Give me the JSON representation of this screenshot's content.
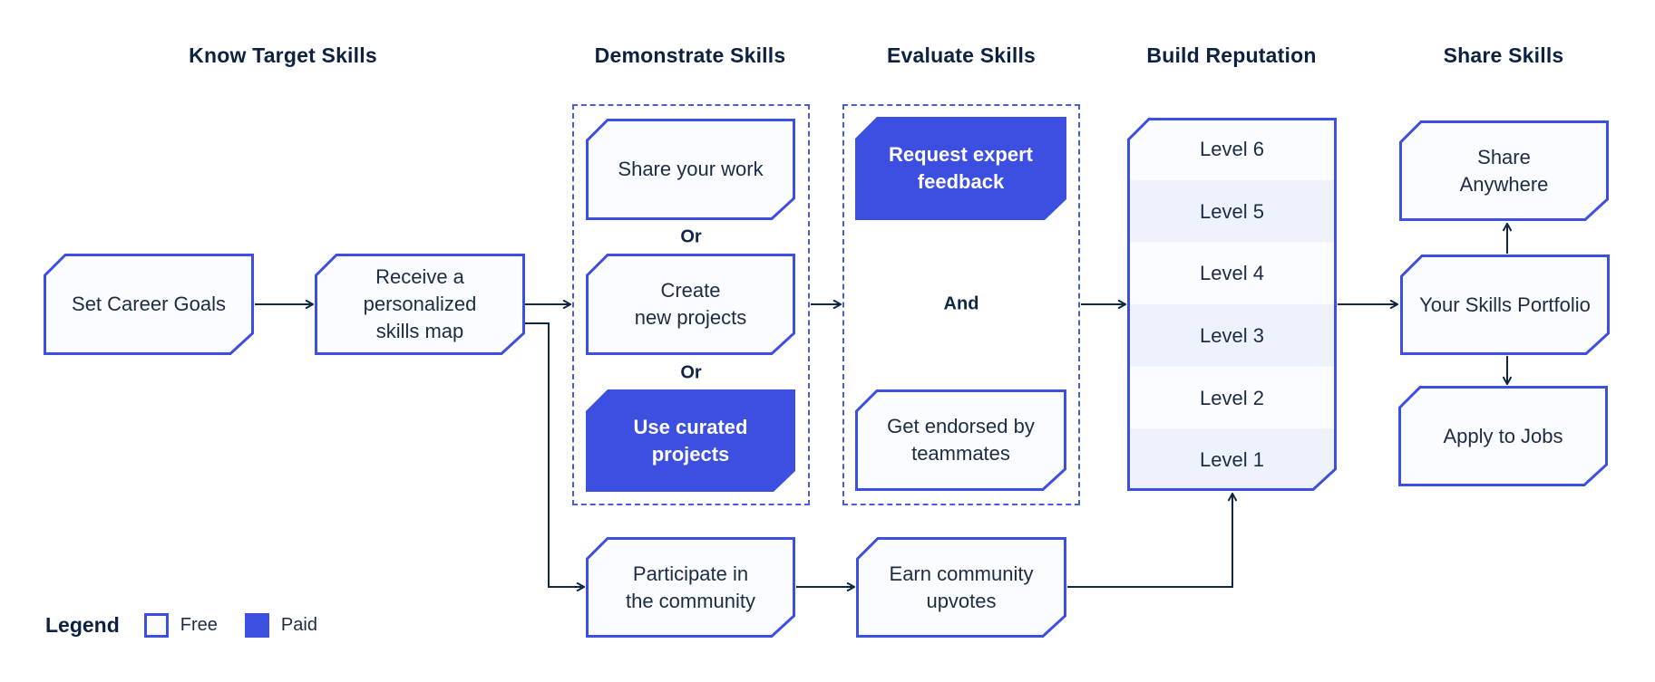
{
  "colors": {
    "accent": "#3d4fe0",
    "text": "#0d2240",
    "free_fill": "#fbfcff",
    "band_fill": "#eef2fd",
    "line": "#0f2744"
  },
  "headings": {
    "know": "Know Target Skills",
    "demonstrate": "Demonstrate Skills",
    "evaluate": "Evaluate Skills",
    "reputation": "Build Reputation",
    "share": "Share Skills"
  },
  "nodes": {
    "set_goals": {
      "label": "Set Career Goals",
      "tier": "free"
    },
    "skills_map": {
      "label": "Receive a\npersonalized\nskills map",
      "tier": "free"
    },
    "share_work": {
      "label": "Share your work",
      "tier": "free"
    },
    "create_projects": {
      "label": "Create\nnew projects",
      "tier": "free"
    },
    "curated_projects": {
      "label": "Use curated\nprojects",
      "tier": "paid"
    },
    "expert_feedback": {
      "label": "Request expert\nfeedback",
      "tier": "paid"
    },
    "endorsed": {
      "label": "Get endorsed by\nteammates",
      "tier": "free"
    },
    "participate": {
      "label": "Participate in\nthe community",
      "tier": "free"
    },
    "upvotes": {
      "label": "Earn community\nupvotes",
      "tier": "free"
    },
    "share_anywhere": {
      "label": "Share\nAnywhere",
      "tier": "free"
    },
    "portfolio": {
      "label": "Your Skills Portfolio",
      "tier": "free"
    },
    "apply_jobs": {
      "label": "Apply to Jobs",
      "tier": "free"
    }
  },
  "connectors": {
    "or_1": "Or",
    "or_2": "Or",
    "and": "And"
  },
  "levels": [
    "Level 6",
    "Level 5",
    "Level 4",
    "Level 3",
    "Level 2",
    "Level 1"
  ],
  "legend": {
    "title": "Legend",
    "free": "Free",
    "paid": "Paid"
  }
}
